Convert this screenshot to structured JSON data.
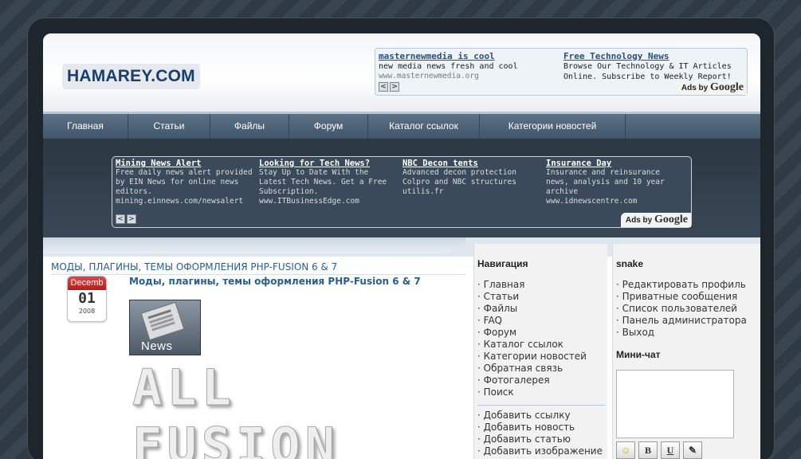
{
  "site": {
    "logo_text": "HAMAREY.COM"
  },
  "top_ad": {
    "units": [
      {
        "title": "masternewmedia is cool",
        "desc": "new media news fresh and cool",
        "url": "www.masternewmedia.org"
      },
      {
        "title": "Free Technology News",
        "desc": "Browse Our Technology & IT Articles Online. Subscribe to Weekly Report!",
        "url": ""
      }
    ],
    "prev": "<",
    "next": ">",
    "ads_by": "Ads by",
    "google": "Google"
  },
  "nav": {
    "items": [
      {
        "label": "Главная"
      },
      {
        "label": "Статьи"
      },
      {
        "label": "Файлы"
      },
      {
        "label": "Форум"
      },
      {
        "label": "Каталог ссылок"
      },
      {
        "label": "Категории новостей"
      }
    ]
  },
  "mid_ad": {
    "units": [
      {
        "title": "Mining News Alert",
        "desc": "Free daily news alert provided by EIN News for online news editors.",
        "url": "mining.einnews.com/newsalert"
      },
      {
        "title": "Looking for Tech News?",
        "desc": "Stay Up to Date With the Latest Tech News. Get a Free Subscription.",
        "url": "www.ITBusinessEdge.com"
      },
      {
        "title": "NBC Decon tents",
        "desc": "Advanced decon protection Colpro and NBC structures",
        "url": "utilis.fr"
      },
      {
        "title": "Insurance Day",
        "desc": "Insurance and reinsurance news, analysis and 10 year archive",
        "url": "www.idnewscentre.com"
      }
    ],
    "prev": "<",
    "next": ">",
    "ads_by": "Ads by",
    "google": "Google"
  },
  "content": {
    "section_title": "МОДЫ, ПЛАГИНЫ, ТЕМЫ ОФОРМЛЕНИЯ PHP-FUSION 6 & 7",
    "post": {
      "month": "Decemb",
      "day": "01",
      "year": "2008",
      "title": "Моды, плагины, темы оформления PHP-Fusion 6 & 7",
      "image_label": "News",
      "banner_text": "ALL FUSION"
    }
  },
  "navigation": {
    "title": "Навигация",
    "items": [
      "Главная",
      "Статьи",
      "Файлы",
      "FAQ",
      "Форум",
      "Каталог ссылок",
      "Категории новостей",
      "Обратная связь",
      "Фотогалерея",
      "Поиск"
    ],
    "submit_items": [
      "Добавить ссылку",
      "Добавить новость",
      "Добавить статью",
      "Добавить изображение"
    ]
  },
  "user_panel": {
    "username": "snake",
    "items": [
      "Редактировать профиль",
      "Приватные сообщения",
      "Список пользователей",
      "Панель администратора",
      "Выход"
    ],
    "shoutbox_title": "Мини-чат",
    "buttons": [
      "☺",
      "B",
      "U",
      "✎"
    ]
  }
}
